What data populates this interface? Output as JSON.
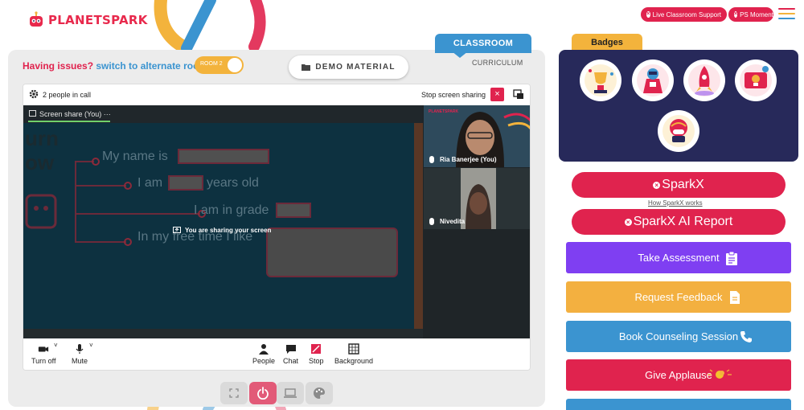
{
  "header": {
    "logo_text": "PLANETSPARK",
    "live_support_label": "Live Classroom Support",
    "ps_moments_label": "PS Moments",
    "hamburger_icon": "menu-icon"
  },
  "classroom": {
    "tab_classroom": "CLASSROOM",
    "tab_curriculum": "CURRICULUM",
    "issues_text": "Having issues?",
    "switch_text": "switch to alternate room",
    "room_toggle_label": "ROOM 2",
    "demo_material_label": "DEMO MATERIAL"
  },
  "meet": {
    "people_count": "2 people in call",
    "stop_sharing_label": "Stop screen sharing",
    "screen_share_label": "Screen share (You)",
    "sharing_message": "You are sharing your screen",
    "slide_lines": [
      "My name is",
      "I am",
      "years old",
      "I am in grade",
      "In my free time I like"
    ],
    "participants": [
      {
        "name": "Ria Banerjee (You)"
      },
      {
        "name": "Nivedita"
      }
    ],
    "controls": {
      "camera": "Turn off",
      "mic": "Mute",
      "people": "People",
      "chat": "Chat",
      "stop": "Stop",
      "background": "Background"
    }
  },
  "right": {
    "badges_title": "Badges",
    "sparkx_label": "SparkX",
    "how_link": "How SparkX works",
    "sparkx_report_label": "SparkX AI Report",
    "actions": [
      {
        "label": "Take Assessment",
        "color": "#7f3ff2",
        "icon": "clipboard-icon"
      },
      {
        "label": "Request Feedback",
        "color": "#f3b040",
        "icon": "document-icon"
      },
      {
        "label": "Book Counseling Session",
        "color": "#3b94d0",
        "icon": "phone-icon"
      },
      {
        "label": "Give Applause",
        "color": "#e0234e",
        "icon": "clap-icon"
      }
    ]
  },
  "colors": {
    "brand_red": "#e0234e",
    "brand_blue": "#3b94d0",
    "brand_yellow": "#f3b33c",
    "badge_panel": "#27295a"
  }
}
